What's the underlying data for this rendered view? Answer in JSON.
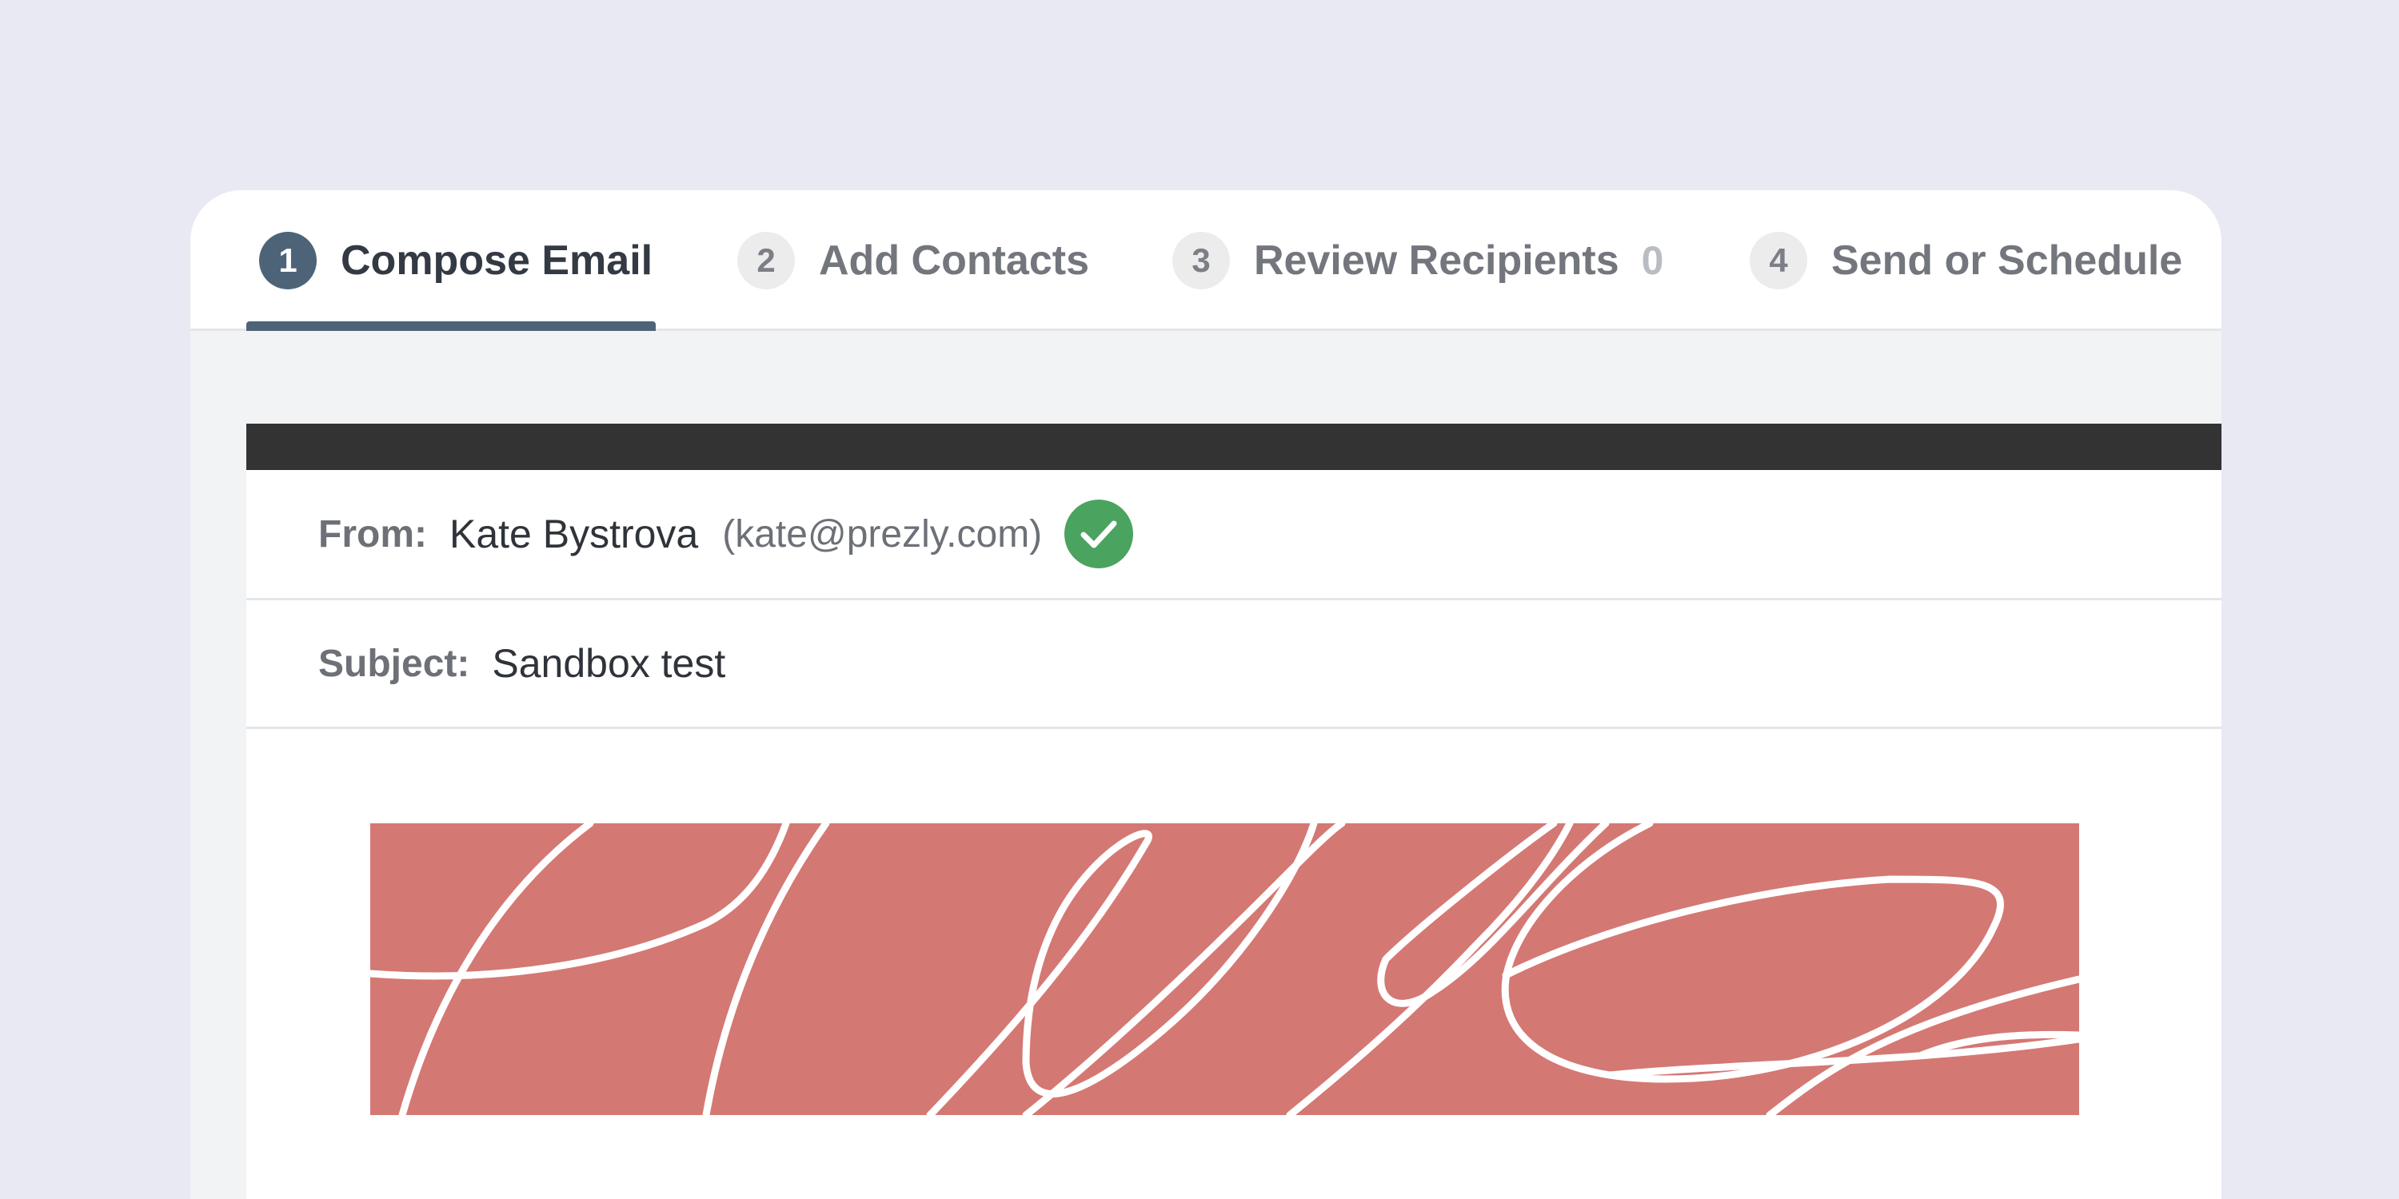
{
  "stepper": {
    "steps": [
      {
        "number": "1",
        "label": "Compose Email",
        "active": true
      },
      {
        "number": "2",
        "label": "Add Contacts",
        "active": false
      },
      {
        "number": "3",
        "label": "Review Recipients",
        "count": "0",
        "active": false
      },
      {
        "number": "4",
        "label": "Send or Schedule",
        "active": false
      }
    ]
  },
  "email": {
    "from_label": "From:",
    "from_name": "Kate Bystrova",
    "from_email": "(kate@prezly.com)",
    "verified_icon": "check-circle-icon",
    "subject_label": "Subject:",
    "subject_value": "Sandbox test"
  },
  "colors": {
    "active_step": "#4d6478",
    "verified": "#4aa35e",
    "banner": "#d47874",
    "toolbar": "#333333",
    "page_background": "#e8e9f2"
  }
}
